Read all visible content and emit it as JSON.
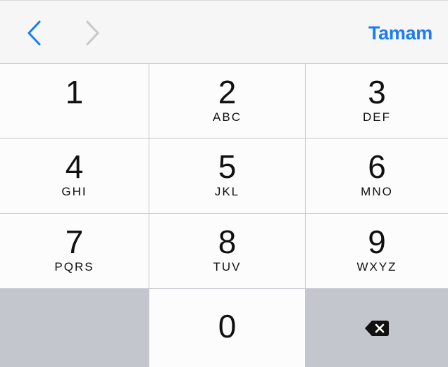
{
  "toolbar": {
    "prev_icon": "chevron-left-icon",
    "next_icon": "chevron-right-icon",
    "done_label": "Tamam",
    "accent_color": "#1b7cf2"
  },
  "keypad": {
    "keys": [
      {
        "digit": "1",
        "letters": ""
      },
      {
        "digit": "2",
        "letters": "ABC"
      },
      {
        "digit": "3",
        "letters": "DEF"
      },
      {
        "digit": "4",
        "letters": "GHI"
      },
      {
        "digit": "5",
        "letters": "JKL"
      },
      {
        "digit": "6",
        "letters": "MNO"
      },
      {
        "digit": "7",
        "letters": "PQRS"
      },
      {
        "digit": "8",
        "letters": "TUV"
      },
      {
        "digit": "9",
        "letters": "WXYZ"
      },
      {
        "digit": "0",
        "letters": ""
      }
    ],
    "delete_icon": "backspace-icon"
  }
}
